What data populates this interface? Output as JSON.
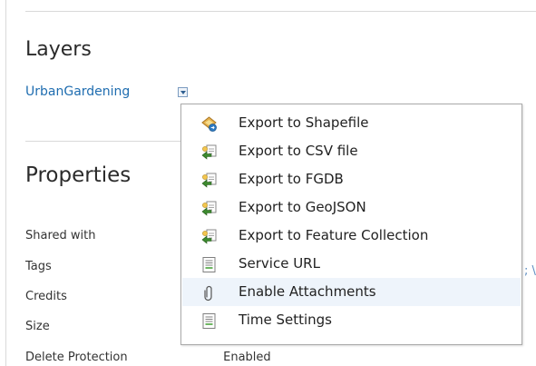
{
  "layers": {
    "title": "Layers",
    "layer_name": "UrbanGardening"
  },
  "properties": {
    "title": "Properties",
    "rows": [
      {
        "label": "Shared with",
        "value": ""
      },
      {
        "label": "Tags",
        "value": ""
      },
      {
        "label": "Credits",
        "value": ""
      },
      {
        "label": "Size",
        "value": ""
      },
      {
        "label": "Delete Protection",
        "value": "Enabled"
      }
    ],
    "clipped_text": "; \\"
  },
  "menu": {
    "items": [
      {
        "label": "Export to Shapefile",
        "icon": "shapefile-export-icon"
      },
      {
        "label": "Export to CSV file",
        "icon": "csv-export-icon"
      },
      {
        "label": "Export to FGDB",
        "icon": "fgdb-export-icon"
      },
      {
        "label": "Export to GeoJSON",
        "icon": "geojson-export-icon"
      },
      {
        "label": "Export to Feature Collection",
        "icon": "feature-collection-export-icon"
      },
      {
        "label": "Service URL",
        "icon": "service-url-icon"
      },
      {
        "label": "Enable Attachments",
        "icon": "paperclip-icon"
      },
      {
        "label": "Time Settings",
        "icon": "time-settings-icon"
      }
    ],
    "hovered_item": "Enable Attachments"
  },
  "colors": {
    "link": "#1f6db0",
    "menu_highlight": "#eef4fb",
    "menu_border": "#a9a9a9",
    "rule": "#d9d9d9"
  }
}
